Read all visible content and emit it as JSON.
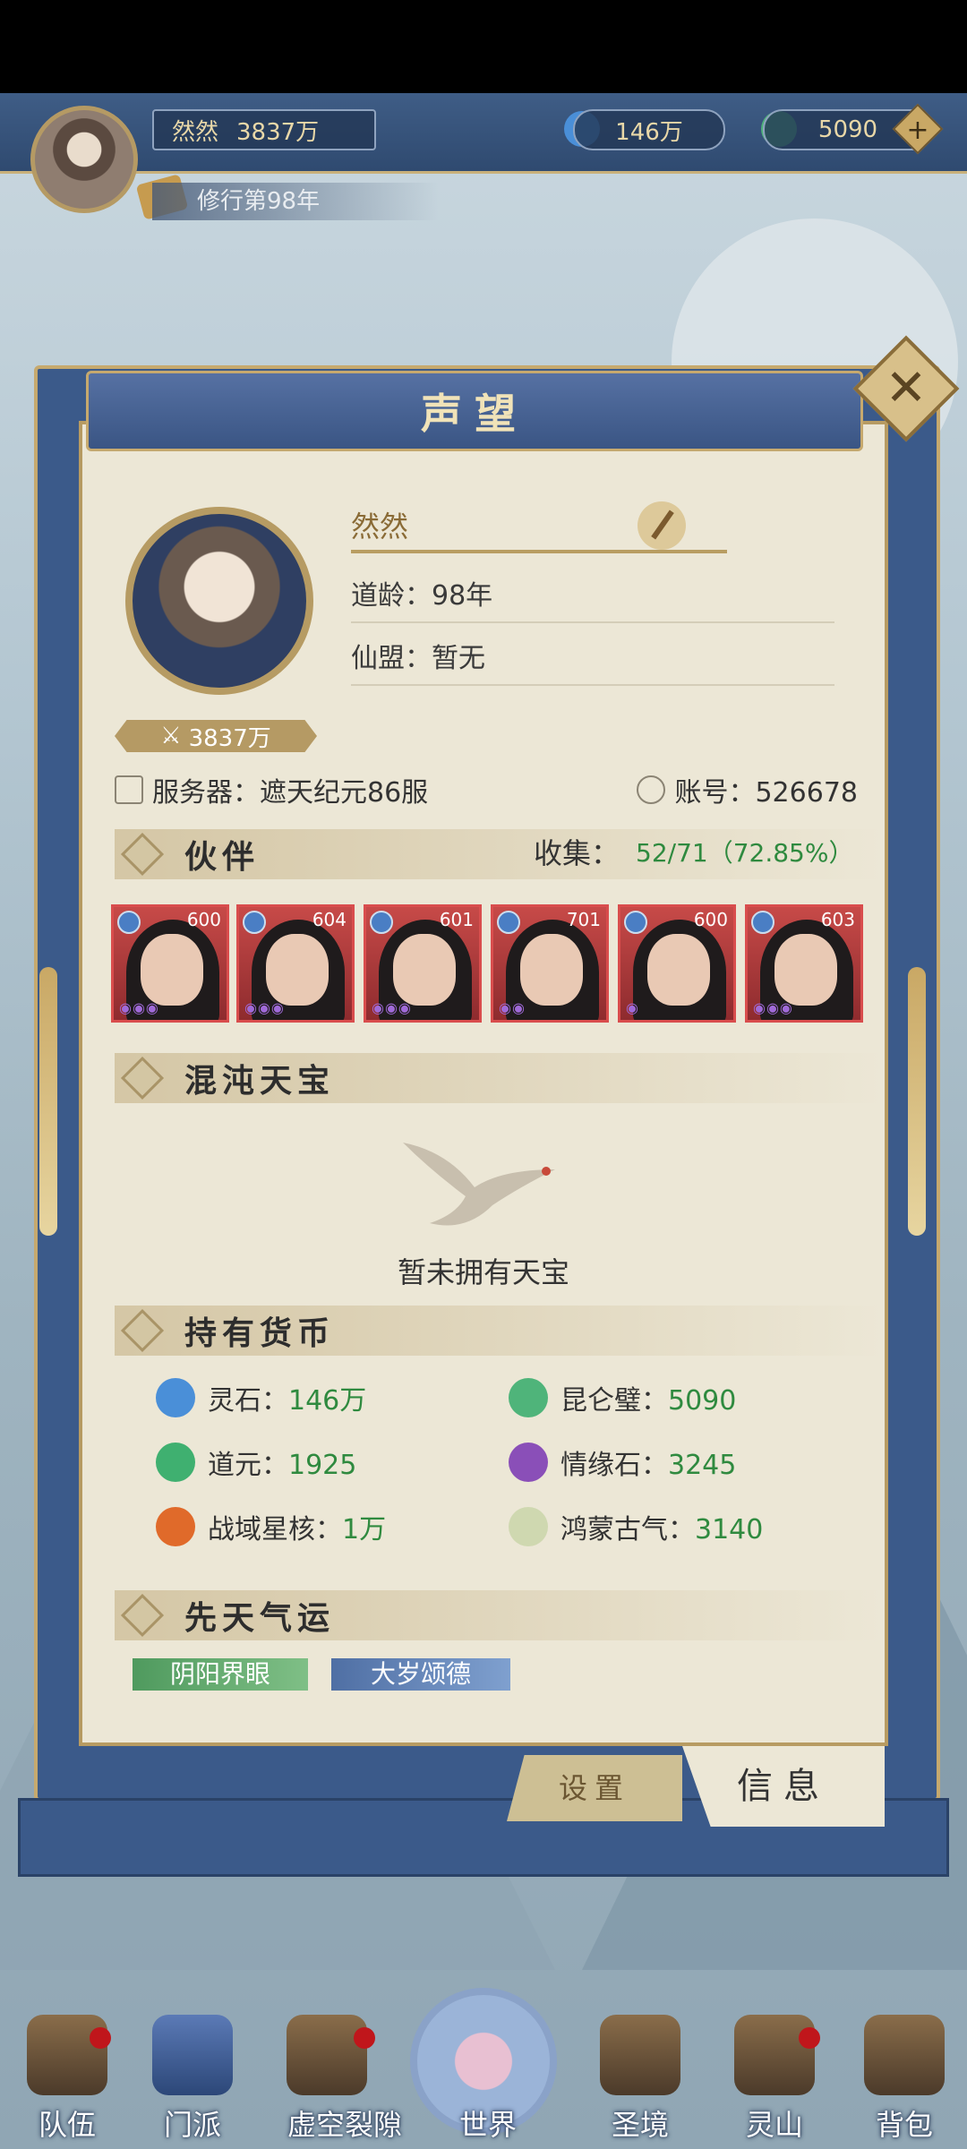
{
  "hud": {
    "player_name": "然然",
    "power": "3837万",
    "spirit_stone": "146万",
    "jade": "5090",
    "plus_label": "+",
    "cultivation_year": "修行第98年"
  },
  "panel": {
    "title": "声望",
    "close_label": "✕",
    "profile": {
      "name": "然然",
      "dao_age": "道龄：98年",
      "alliance": "仙盟：暂无",
      "power": "3837万",
      "server": "服务器：遮天纪元86服",
      "account": "账号：526678"
    },
    "partners": {
      "title": "伙伴",
      "collect_label": "收集：",
      "collect_value": "52/71（72.85%）",
      "cards": [
        {
          "level": "600",
          "stars": "◉◉◉"
        },
        {
          "level": "604",
          "stars": "◉◉◉"
        },
        {
          "level": "601",
          "stars": "◉◉◉"
        },
        {
          "level": "701",
          "stars": "◉◉"
        },
        {
          "level": "600",
          "stars": "◉"
        },
        {
          "level": "603",
          "stars": "◉◉◉"
        }
      ]
    },
    "treasure": {
      "title": "混沌天宝",
      "empty_text": "暂未拥有天宝"
    },
    "currency": {
      "title": "持有货币",
      "items": [
        {
          "label": "灵石：",
          "amount": "146万",
          "color": "#4a8fd8"
        },
        {
          "label": "昆仑璧：",
          "amount": "5090",
          "color": "#4fb47a"
        },
        {
          "label": "道元：",
          "amount": "1925",
          "color": "#3fb070"
        },
        {
          "label": "情缘石：",
          "amount": "3245",
          "color": "#8a4fb8"
        },
        {
          "label": "战域星核：",
          "amount": "1万",
          "color": "#e06a2a"
        },
        {
          "label": "鸿蒙古气：",
          "amount": "3140",
          "color": "#cfd8b0"
        }
      ]
    },
    "fortune": {
      "title": "先天气运",
      "tags": [
        "阴阳界眼",
        "大岁颂德"
      ]
    },
    "tabs": {
      "settings": "设置",
      "info": "信息"
    }
  },
  "nav": {
    "items": [
      "队伍",
      "门派",
      "虚空裂隙",
      "世界",
      "圣境",
      "灵山",
      "背包"
    ]
  }
}
